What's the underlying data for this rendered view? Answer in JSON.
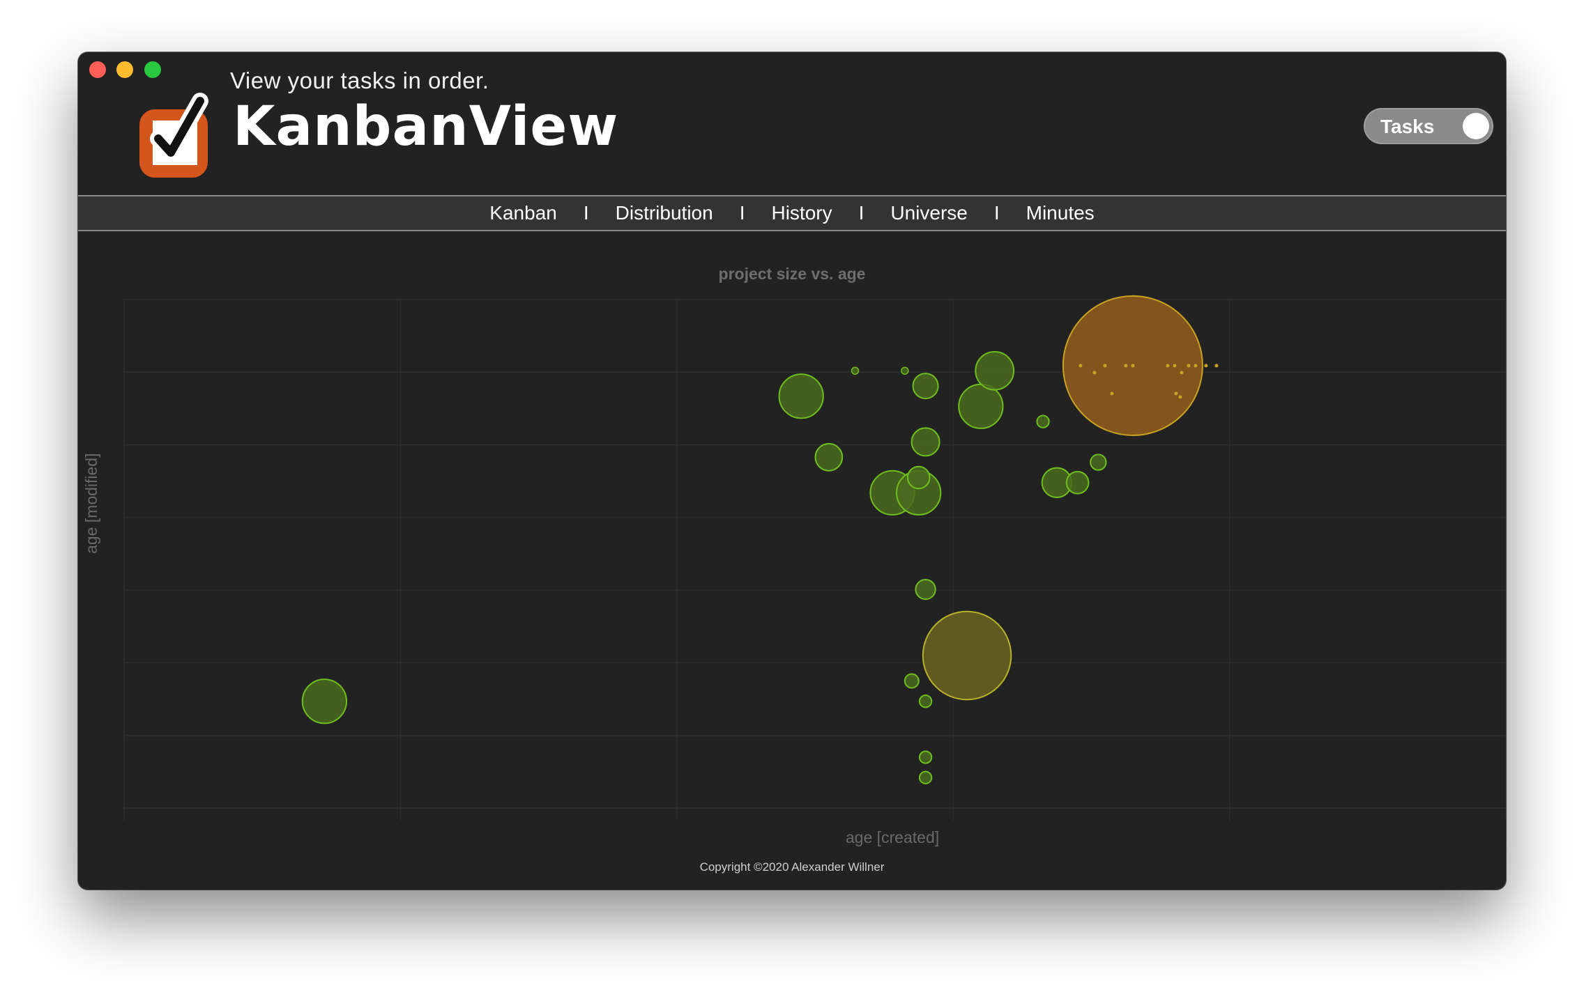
{
  "window": {
    "controls": [
      "close",
      "minimize",
      "maximize"
    ]
  },
  "header": {
    "tagline": "View your tasks in order.",
    "brand": "KanbanView",
    "logo_icon": "checkbox-check-icon",
    "toggle_label": "Tasks",
    "toggle_on": true
  },
  "nav": {
    "items": [
      "Kanban",
      "Distribution",
      "History",
      "Universe",
      "Minutes"
    ],
    "separator": "I"
  },
  "chart": {
    "title": "project size vs. age",
    "xlabel": "age [created]",
    "ylabel": "age [modified]"
  },
  "footer": {
    "copyright": "Copyright ©2020 Alexander Willner"
  },
  "colors": {
    "background": "#222222",
    "bubble_green_fill": "#4a6b1f",
    "bubble_green_stroke": "#6fbf1f",
    "bubble_olive_fill": "#6a6420",
    "bubble_olive_stroke": "#b8b22a",
    "bubble_orange_fill": "#8f5a1e",
    "bubble_orange_stroke": "#c9a320"
  },
  "chart_data": {
    "type": "scatter",
    "title": "project size vs. age",
    "xlabel": "age [created]",
    "ylabel": "age [modified]",
    "grid": true,
    "points": [
      {
        "x": 0.145,
        "y": 0.21,
        "size": 4
      },
      {
        "x": 0.49,
        "y": 0.81,
        "size": 4
      },
      {
        "x": 0.51,
        "y": 0.69,
        "size": 1.5
      },
      {
        "x": 0.529,
        "y": 0.86,
        "size": 0.1
      },
      {
        "x": 0.556,
        "y": 0.62,
        "size": 4
      },
      {
        "x": 0.565,
        "y": 0.86,
        "size": 0.1
      },
      {
        "x": 0.57,
        "y": 0.25,
        "size": 0.4
      },
      {
        "x": 0.575,
        "y": 0.62,
        "size": 4
      },
      {
        "x": 0.575,
        "y": 0.65,
        "size": 1
      },
      {
        "x": 0.58,
        "y": 0.83,
        "size": 1.3
      },
      {
        "x": 0.58,
        "y": 0.72,
        "size": 1.6
      },
      {
        "x": 0.58,
        "y": 0.43,
        "size": 0.8
      },
      {
        "x": 0.58,
        "y": 0.21,
        "size": 0.3
      },
      {
        "x": 0.58,
        "y": 0.1,
        "size": 0.3
      },
      {
        "x": 0.58,
        "y": 0.06,
        "size": 0.3
      },
      {
        "x": 0.61,
        "y": 0.3,
        "size": 16
      },
      {
        "x": 0.62,
        "y": 0.79,
        "size": 4
      },
      {
        "x": 0.63,
        "y": 0.86,
        "size": 3
      },
      {
        "x": 0.665,
        "y": 0.76,
        "size": 0.3
      },
      {
        "x": 0.675,
        "y": 0.64,
        "size": 1.8
      },
      {
        "x": 0.69,
        "y": 0.64,
        "size": 1
      },
      {
        "x": 0.705,
        "y": 0.68,
        "size": 0.5
      },
      {
        "x": 0.73,
        "y": 0.87,
        "size": 40
      }
    ]
  }
}
